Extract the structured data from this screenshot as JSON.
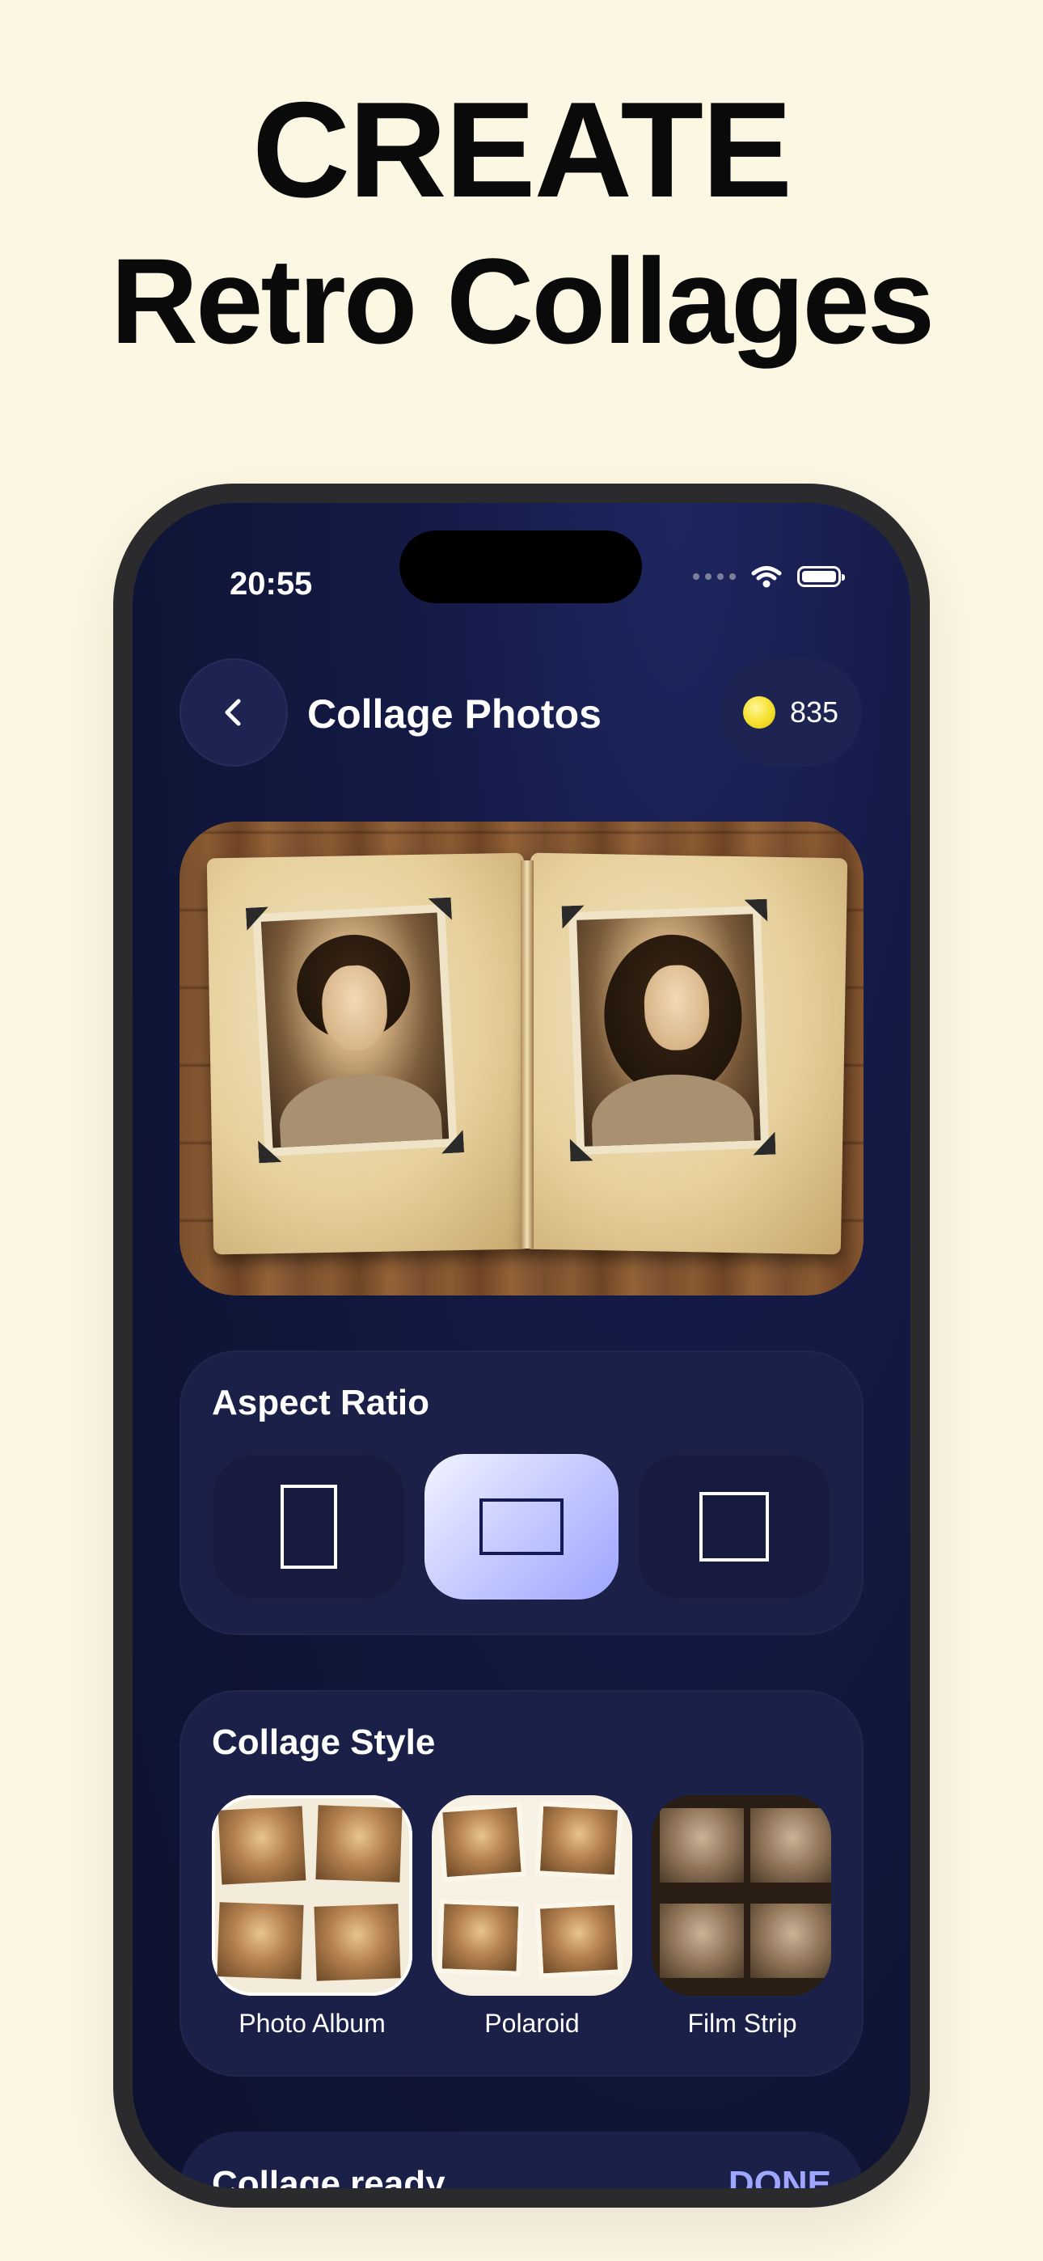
{
  "headline": {
    "line1": "CREATE",
    "line2": "Retro Collages"
  },
  "status_bar": {
    "time": "20:55"
  },
  "header": {
    "title": "Collage Photos",
    "coins": "835"
  },
  "aspect_ratio": {
    "title": "Aspect Ratio",
    "options": [
      "portrait",
      "landscape",
      "square"
    ],
    "selected": "landscape"
  },
  "collage_style": {
    "title": "Collage Style",
    "options": [
      {
        "label": "Photo Album"
      },
      {
        "label": "Polaroid"
      },
      {
        "label": "Film Strip"
      }
    ]
  },
  "footer_card": {
    "title": "Collage ready",
    "action": "DONE"
  },
  "colors": {
    "background": "#fbf7e3",
    "screen": "#131a44",
    "accent": "#9fa6ff",
    "coin": "#f7e33a"
  },
  "icons": [
    "back-chevron-icon",
    "coin-icon",
    "wifi-icon",
    "battery-icon",
    "signal-dots-icon"
  ]
}
